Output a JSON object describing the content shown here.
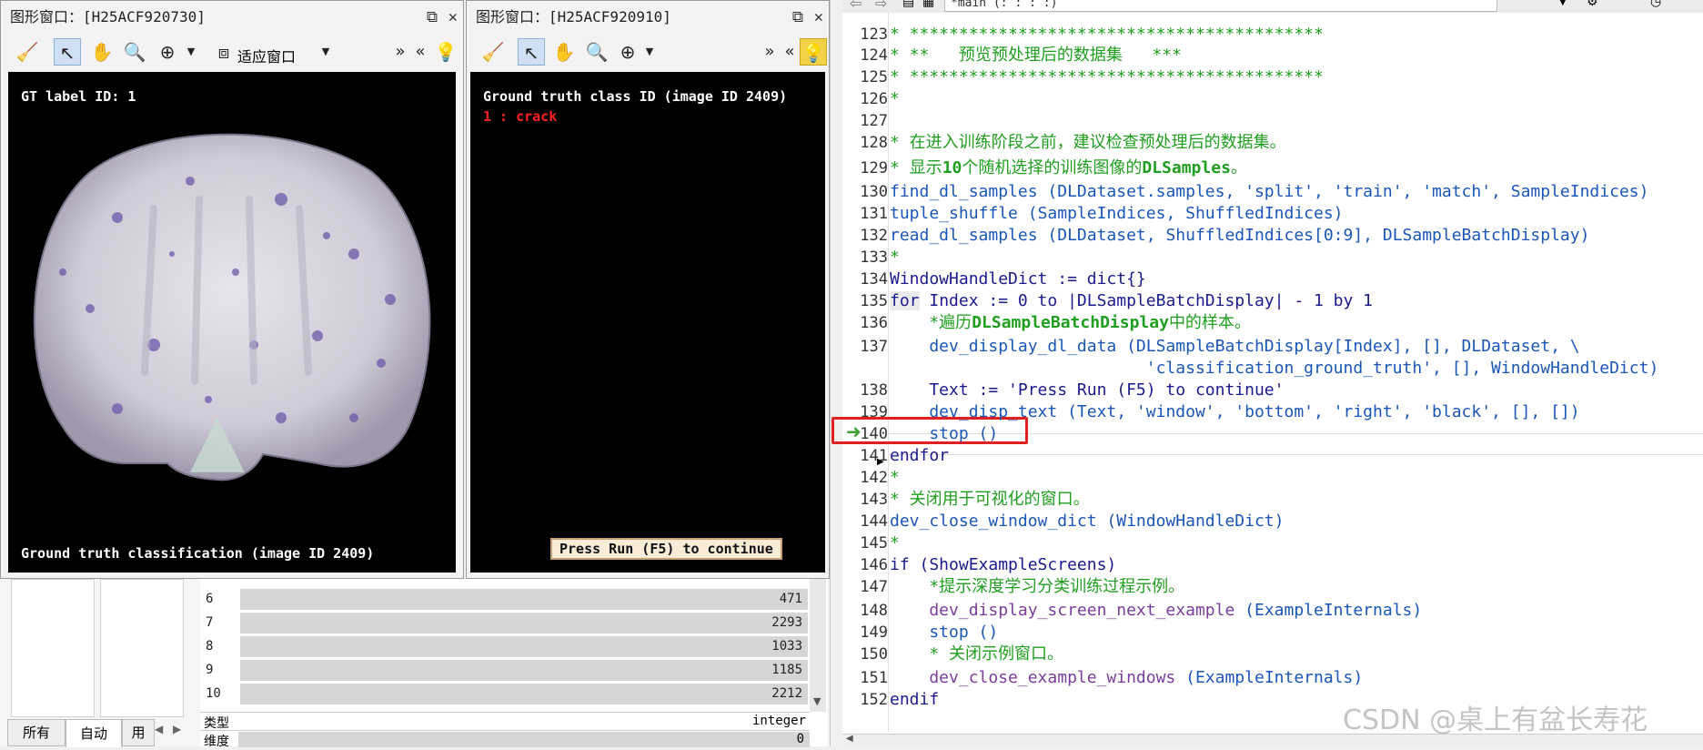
{
  "window1": {
    "title": "图形窗口：[H25ACF920730]",
    "fit_label": "适应窗口",
    "gt_label": "GT label ID: 1",
    "bottom_text": "Ground truth classification (image ID 2409)"
  },
  "window2": {
    "title": "图形窗口：[H25ACF920910]",
    "header_text": "Ground truth class ID (image ID 2409)",
    "class_text": "1 : crack",
    "run_hint": "Press Run (F5) to continue"
  },
  "toolbar": {
    "chevrons_right": "»",
    "chevrons_left": "«",
    "procedure_selector": "*main (: : : :)"
  },
  "variables": {
    "rows": [
      {
        "idx": "6",
        "value": "471"
      },
      {
        "idx": "7",
        "value": "2293"
      },
      {
        "idx": "8",
        "value": "1033"
      },
      {
        "idx": "9",
        "value": "1185"
      },
      {
        "idx": "10",
        "value": "2212"
      }
    ],
    "type_label": "类型",
    "type_value": "integer",
    "dim_label": "维度",
    "dim_value": "0"
  },
  "tabs": {
    "all": "所有",
    "auto": "自动",
    "used": "用"
  },
  "code": {
    "line_numbers": [
      "123",
      "124",
      "125",
      "126",
      "127",
      "128",
      "129",
      "130",
      "131",
      "132",
      "133",
      "134",
      "135",
      "136",
      "137",
      "",
      "138",
      "139",
      "140",
      "141",
      "142",
      "143",
      "144",
      "145",
      "146",
      "147",
      "148",
      "149",
      "150",
      "151",
      "152"
    ],
    "l123": "* ******************************************",
    "l124": "* **   预览预处理后的数据集   ***",
    "l125": "* ******************************************",
    "l126": "*",
    "l128": "* 在进入训练阶段之前，建议检查预处理后的数据集。",
    "l129a": "* 显示",
    "l129b": "10",
    "l129c": "个随机选择的训练图像的",
    "l129d": "DLSamples",
    "l129e": "。",
    "l130fn": "find_dl_samples",
    "l130args": " (DLDataset.samples, 'split', 'train', 'match', SampleIndices)",
    "l131fn": "tuple_shuffle",
    "l131args": " (SampleIndices, ShuffledIndices)",
    "l132fn": "read_dl_samples",
    "l132args": " (DLDataset, ShuffledIndices[0:9], DLSampleBatchDisplay)",
    "l133": "*",
    "l134": "WindowHandleDict := dict{}",
    "l135kw": "for",
    "l135rest": " Index := 0 to |DLSampleBatchDisplay| - 1 by 1",
    "l136a": "    *遍历",
    "l136b": "DLSampleBatchDisplay",
    "l136c": "中的样本。",
    "l137fn": "    dev_display_dl_data",
    "l137args": " (DLSampleBatchDisplay[Index], [], DLDataset, \\",
    "l137cont": "                          'classification_ground_truth', [], WindowHandleDict)",
    "l138": "    Text := 'Press Run (F5) to continue'",
    "l139fn": "    dev_disp_text",
    "l139args": " (Text, 'window', 'bottom', 'right', 'black', [], [])",
    "l140fn": "    stop",
    "l140args": " ()",
    "l141": "endfor",
    "l142": "*",
    "l143": "* 关闭用于可视化的窗口。",
    "l144fn": "dev_close_window_dict",
    "l144args": " (WindowHandleDict)",
    "l145": "*",
    "l146": "if (ShowExampleScreens)",
    "l147": "    *提示深度学习分类训练过程示例。",
    "l148fn": "    dev_display_screen_next_example",
    "l148args": " (ExampleInternals)",
    "l149fn": "    stop",
    "l149args": " ()",
    "l150": "    * 关闭示例窗口。",
    "l151fn": "    dev_close_example_windows",
    "l151args": " (ExampleInternals)",
    "l152": "endif"
  },
  "watermark": "CSDN @桌上有盆长寿花",
  "colors": {
    "highlight_box": "#e02020",
    "comment": "#1f9e1f",
    "function": "#1a56b8",
    "class_text": "#ff2020"
  }
}
